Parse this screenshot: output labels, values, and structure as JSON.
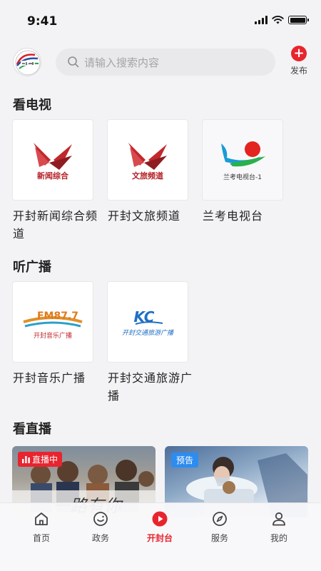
{
  "status": {
    "time": "9:41"
  },
  "header": {
    "search_placeholder": "请输入搜索内容",
    "publish_label": "发布",
    "publish_symbol": "+"
  },
  "sections": {
    "tv": {
      "title": "看电视",
      "items": [
        {
          "label": "开封新闻综合频道",
          "logo_text": "新闻综合"
        },
        {
          "label": "开封文旅频道",
          "logo_text": "文旅频道"
        },
        {
          "label": "兰考电视台",
          "logo_text": "兰考电视台-1"
        }
      ]
    },
    "radio": {
      "title": "听广播",
      "items": [
        {
          "label": "开封音乐广播",
          "logo_text": "FM87.7",
          "logo_sub": "开封音乐广播"
        },
        {
          "label": "开封交通旅游广播",
          "logo_text": "KC",
          "logo_sub": "开封交通旅游广播"
        }
      ]
    },
    "live": {
      "title": "看直播",
      "items": [
        {
          "badge": "直播中",
          "overlay_text": "一路有你"
        },
        {
          "badge": "预告"
        }
      ]
    }
  },
  "tabbar": {
    "tabs": [
      {
        "label": "首页",
        "active": false
      },
      {
        "label": "政务",
        "active": false
      },
      {
        "label": "开封台",
        "active": true
      },
      {
        "label": "服务",
        "active": false
      },
      {
        "label": "我的",
        "active": false
      }
    ]
  },
  "colors": {
    "accent": "#e8242f",
    "preview": "#2d8cf0",
    "background": "#f3f3f5"
  }
}
